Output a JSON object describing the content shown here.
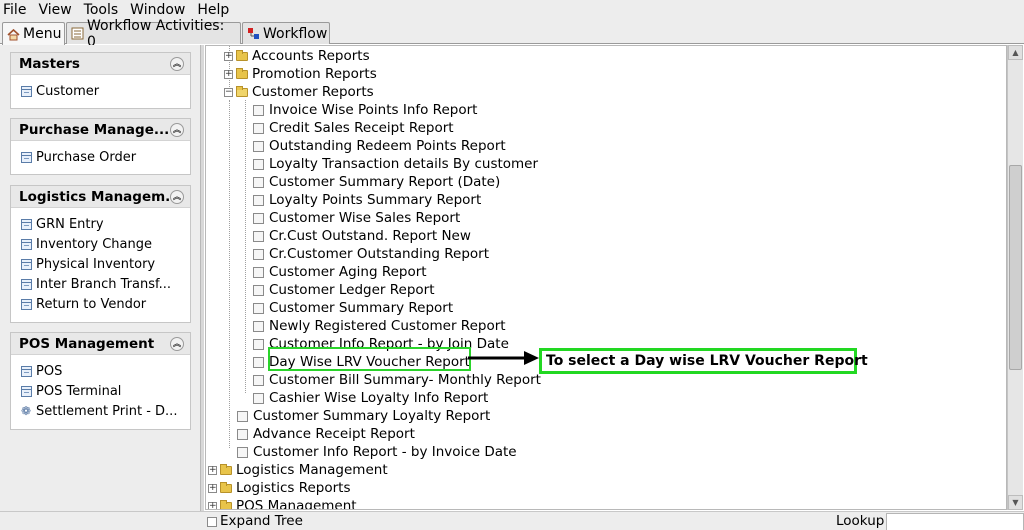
{
  "menubar": {
    "items": [
      {
        "label": "File"
      },
      {
        "label": "View"
      },
      {
        "label": "Tools"
      },
      {
        "label": "Window"
      },
      {
        "label": "Help"
      }
    ]
  },
  "tabs": [
    {
      "label": "Menu",
      "icon": "home-icon"
    },
    {
      "label": "Workflow Activities: 0",
      "icon": "workflow-activities-icon"
    },
    {
      "label": "Workflow",
      "icon": "workflow-icon"
    }
  ],
  "sidebar": {
    "sections": [
      {
        "title": "Masters",
        "items": [
          {
            "label": "Customer"
          }
        ]
      },
      {
        "title": "Purchase Manage...",
        "items": [
          {
            "label": "Purchase Order"
          }
        ]
      },
      {
        "title": "Logistics Managem...",
        "items": [
          {
            "label": "GRN Entry"
          },
          {
            "label": "Inventory Change"
          },
          {
            "label": "Physical Inventory"
          },
          {
            "label": "Inter Branch Transf..."
          },
          {
            "label": "Return to Vendor"
          }
        ]
      },
      {
        "title": "POS Management",
        "items": [
          {
            "label": "POS"
          },
          {
            "label": "POS Terminal"
          },
          {
            "label": "Settlement Print - D..."
          }
        ]
      }
    ]
  },
  "tree": {
    "top_folders": [
      {
        "label": "Accounts Reports"
      },
      {
        "label": "Promotion Reports"
      },
      {
        "label": "Customer Reports"
      }
    ],
    "customer_reports": [
      {
        "label": "Invoice Wise Points Info Report"
      },
      {
        "label": "Credit Sales Receipt Report"
      },
      {
        "label": "Outstanding Redeem Points Report"
      },
      {
        "label": "Loyalty Transaction details By customer"
      },
      {
        "label": "Customer Summary Report (Date)"
      },
      {
        "label": "Loyalty Points Summary Report"
      },
      {
        "label": "Customer Wise Sales Report"
      },
      {
        "label": "Cr.Cust Outstand. Report New"
      },
      {
        "label": "Cr.Customer Outstanding Report"
      },
      {
        "label": "Customer Aging Report"
      },
      {
        "label": "Customer Ledger Report"
      },
      {
        "label": "Customer Summary Report"
      },
      {
        "label": "Newly Registered Customer Report"
      },
      {
        "label": "Customer Info Report - by Join Date"
      },
      {
        "label": "Day Wise LRV Voucher Report"
      },
      {
        "label": "Customer Bill Summary- Monthly Report"
      },
      {
        "label": "Cashier Wise Loyalty Info Report"
      }
    ],
    "sibling_reports": [
      {
        "label": "Customer Summary Loyalty Report"
      },
      {
        "label": "Advance Receipt Report"
      },
      {
        "label": "Customer Info Report - by Invoice Date"
      }
    ],
    "root_folders": [
      {
        "label": "Logistics Management"
      },
      {
        "label": "Logistics Reports"
      },
      {
        "label": "POS Management"
      }
    ]
  },
  "annotation": {
    "text": "To select a Day wise LRV Voucher Report",
    "color": "#22d822"
  },
  "bottombar": {
    "expand_tree": "Expand Tree",
    "lookup": "Lookup",
    "lookup_value": ""
  }
}
